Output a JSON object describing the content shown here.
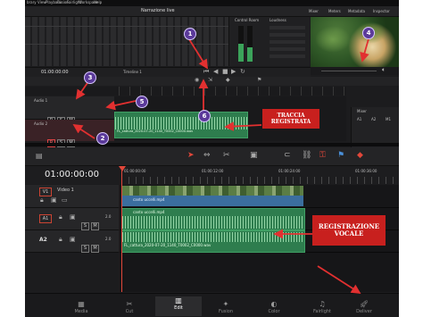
{
  "top": {
    "menu": [
      "brary",
      "View",
      "Playback",
      "Fusion",
      "Fairlight",
      "Workspace",
      "Help"
    ],
    "project_title": "Narrazione live",
    "right_buttons": [
      "Mixer",
      "Meters",
      "Metadata",
      "Inspector"
    ],
    "control_room": "Control Room",
    "loudness": "Loudness",
    "small_timecode": "01:00:00:00",
    "timeline_name": "Timeline 1"
  },
  "mini_tracks": {
    "a1_label": "Audio 1",
    "a2_label": "Audio 2",
    "clip_name": "FL_cattura_2020-07-20_1140_T0002_C0000.wav",
    "mixer_title": "Mixer",
    "mixer_channels": [
      "A1",
      "A2",
      "M1"
    ]
  },
  "edit": {
    "timecode": "01:00:00:00",
    "ruler": [
      "01:00:00:00",
      "01:00:12:00",
      "01:00:24:00",
      "01:00:36:00"
    ],
    "tracks": [
      {
        "id": "V1",
        "name": "Video 1"
      },
      {
        "id": "A1",
        "volume": "2.0"
      },
      {
        "id": "A2",
        "volume": "2.0"
      }
    ],
    "video_clip": "canto uccelli.mp4",
    "audio_clip": "canto uccelli.mp4",
    "recorded_clip": "FL_cattura_2020-07-20_1140_T0002_C0000.wav",
    "solo_label": "S",
    "mute_label": "M"
  },
  "annotations": {
    "badges": [
      "1",
      "2",
      "3",
      "4",
      "5",
      "6"
    ],
    "traccia": [
      "TRACCIA",
      "REGISTRATA"
    ],
    "registrazione": [
      "REGISTRAZIONE",
      "VOCALE"
    ]
  },
  "tabs": [
    "Media",
    "Cut",
    "Edit",
    "Fusion",
    "Color",
    "Fairlight",
    "Deliver"
  ],
  "active_tab": "Edit",
  "colors": {
    "accent_red": "#c8201e",
    "badge_purple": "#5b3a9a",
    "audio_green": "#2e7d4e",
    "video_blue": "#3b6e9e",
    "playhead": "#e2473a"
  }
}
